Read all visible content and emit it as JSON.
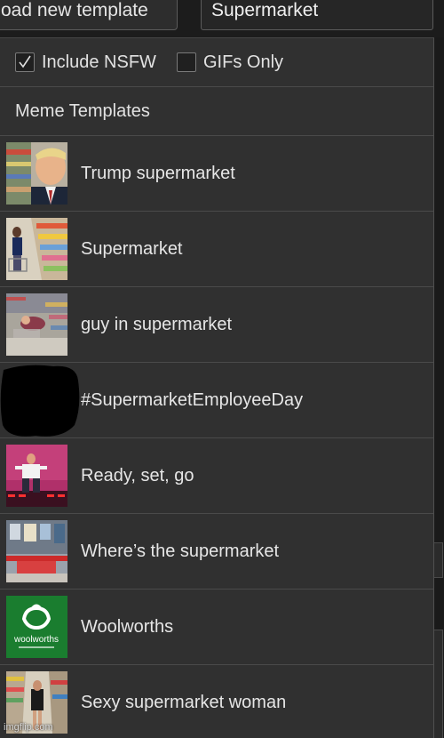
{
  "toolbar": {
    "upload_label": "oad new template",
    "search_value": "Supermarket"
  },
  "filters": {
    "include_nsfw": {
      "label": "Include NSFW",
      "checked": true
    },
    "gifs_only": {
      "label": "GIFs Only",
      "checked": false
    }
  },
  "section": {
    "title": "Meme Templates"
  },
  "templates": [
    {
      "label": "Trump supermarket",
      "thumb": "trump-thumbnail"
    },
    {
      "label": "Supermarket",
      "thumb": "supermarket-aisle-thumbnail"
    },
    {
      "label": "guy in supermarket",
      "thumb": "guy-in-supermarket-thumbnail"
    },
    {
      "label": "#SupermarketEmployeeDay",
      "thumb": "redacted-thumbnail"
    },
    {
      "label": "Ready, set, go",
      "thumb": "ready-set-go-thumbnail"
    },
    {
      "label": "Where’s the supermarket",
      "thumb": "chinatown-shop-thumbnail"
    },
    {
      "label": "Woolworths",
      "thumb": "woolworths-logo-thumbnail",
      "logo_text": "woolworths"
    },
    {
      "label": "Sexy supermarket woman",
      "thumb": "supermarket-woman-thumbnail"
    }
  ],
  "watermark": "imgflip.com",
  "colors": {
    "panel": "#303030",
    "background": "#1c1c1c",
    "text": "#e6e6e6",
    "woolworths_green": "#1a7d2f"
  }
}
